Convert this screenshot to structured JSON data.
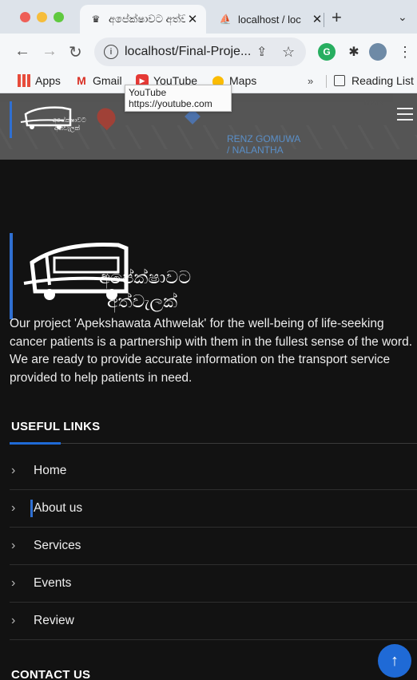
{
  "browser": {
    "tabs": [
      {
        "title": "අපේක්ෂාවට අත්වැ",
        "active": true
      },
      {
        "title": "localhost / loc",
        "active": false
      }
    ],
    "new_tab_icon": "plus-icon",
    "address": "localhost/Final-Proje...",
    "bookmarks": [
      {
        "label": "Apps",
        "icon": "apps-grid-icon"
      },
      {
        "label": "Gmail",
        "icon": "gmail-icon"
      },
      {
        "label": "YouTube",
        "icon": "youtube-icon"
      },
      {
        "label": "Maps",
        "icon": "maps-icon"
      }
    ],
    "more_bookmarks": "»",
    "reading_list": "Reading List",
    "tooltip": {
      "title": "YouTube",
      "url": "https://youtube.com"
    }
  },
  "header": {
    "map_label": "RENZ GOMUWA\n/ NALANTHA",
    "map_label_2": "Mark"
  },
  "logo": {
    "text_line1": "අපේක්ෂාවට",
    "text_line2": "අත්වැලක්"
  },
  "about": {
    "text": "Our project 'Apekshawata Athwelak' for the well-being of life-seeking cancer patients is a partnership with them in the fullest sense of the word. We are ready to provide accurate information on the transport service provided to help patients in need."
  },
  "useful_links": {
    "title": "USEFUL LINKS",
    "items": [
      {
        "label": "Home"
      },
      {
        "label": "About us"
      },
      {
        "label": "Services"
      },
      {
        "label": "Events"
      },
      {
        "label": "Review"
      }
    ]
  },
  "contact": {
    "title": "CONTACT US"
  },
  "colors": {
    "accent": "#1f6ad6",
    "page_bg": "#121212"
  }
}
